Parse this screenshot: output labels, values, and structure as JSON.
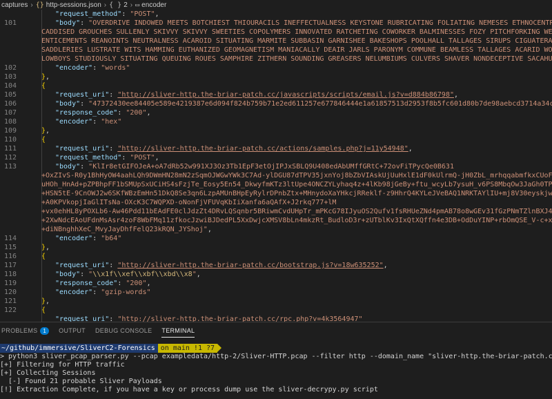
{
  "breadcrumb": {
    "root": "captures",
    "file_icon": "{}",
    "file": "http-sessions.json",
    "node_icon": "{ }",
    "node_num": "2",
    "node": "encoder"
  },
  "editor": {
    "lines": [
      {
        "n": "",
        "indent": 1,
        "html": "<span class='k'>\"request_method\"</span><span class='p'>: </span><span class='s'>\"POST\"</span><span class='p'>,</span>"
      },
      {
        "n": "101",
        "indent": 1,
        "html": "<span class='k'>\"body\"</span><span class='p'>: </span><span class='s'>\"OVERDRIVE INDOWED MEETS BOTCHIEST THIOURACILS INEFFECTUALNESS KEYSTONE RUBRICATING FOLIATING NEMESES ETHNOCENTRIC UNDERGOES FA</span>"
      },
      {
        "n": "",
        "indent": 0,
        "html": "<span class='s'>CADDISED GROUCHES SULLENLY SKIVVY SKIVVY SWEETIES COPOLYMERS INNOVATED RATCHETING COWORKER BALMINESSES FOZY PITCHFORKING WETTISH HUNGOV</span>"
      },
      {
        "n": "",
        "indent": 0,
        "html": "<span class='s'>ENTICEMENTS REANOINTS NEUTRALNESS ACAROID SITUATING MARMITE SUBBASIN GARNISHEE BAKESHOPS POOLHALL TALLAGES SIRUPS CIGUATERAS OMNIFIC IN</span>"
      },
      {
        "n": "",
        "indent": 0,
        "html": "<span class='s'>SADDLERIES LUSTRATE WITS HAMMING EUTHANIZED GEOMAGNETISM MANIACALLY DEAIR JARLS PARONYM COMMUNE BEAMLESS TALLAGES ACARID WOORALI SITUA</span>"
      },
      {
        "n": "",
        "indent": 0,
        "html": "<span class='s'>LOWBOYS STUDIOUSLY SITUATING QUEUING ROUES SAMPHIRE ZITHERN SOUNDING GREASERS NELUMBIUMS CULVERS SHAVER NONDECEPTIVE SACAHUISTE TWISTS</span>"
      },
      {
        "n": "102",
        "indent": 1,
        "html": "<span class='k'>\"encoder\"</span><span class='p'>: </span><span class='s'>\"words\"</span>"
      },
      {
        "n": "103",
        "indent": 0,
        "html": "<span class='y'>}</span><span class='p'>,</span>"
      },
      {
        "n": "104",
        "indent": 0,
        "html": "<span class='y'>{</span>"
      },
      {
        "n": "105",
        "indent": 1,
        "html": "<span class='k'>\"request_uri\"</span><span class='p'>: </span><span class='u'>\"http://sliver-http.the-briar-patch.cc/javascripts/scripts/email.js?v=d884b86798\"</span><span class='p'>,</span>"
      },
      {
        "n": "106",
        "indent": 1,
        "html": "<span class='k'>\"body\"</span><span class='p'>: </span><span class='s'>\"47372430ee84405e589e4219387e6d094f824b759b71e2ed611257e677846444e1a61857513d2953f8b5fc601d80b7de98aebcd3714a34c7dc2ba5bc1fc5d</span>"
      },
      {
        "n": "107",
        "indent": 1,
        "html": "<span class='k'>\"response_code\"</span><span class='p'>: </span><span class='s'>\"200\"</span><span class='p'>,</span>"
      },
      {
        "n": "108",
        "indent": 1,
        "html": "<span class='k'>\"encoder\"</span><span class='p'>: </span><span class='s'>\"hex\"</span>"
      },
      {
        "n": "109",
        "indent": 0,
        "html": "<span class='y'>}</span><span class='p'>,</span>"
      },
      {
        "n": "110",
        "indent": 0,
        "html": "<span class='y'>{</span>"
      },
      {
        "n": "111",
        "indent": 1,
        "html": "<span class='k'>\"request_uri\"</span><span class='p'>: </span><span class='u'>\"http://sliver-http.the-briar-patch.cc/actions/samples.php?j=11y54948\"</span><span class='p'>,</span>"
      },
      {
        "n": "112",
        "indent": 1,
        "html": "<span class='k'>\"request_method\"</span><span class='p'>: </span><span class='s'>\"POST\"</span><span class='p'>,</span>"
      },
      {
        "n": "113",
        "indent": 1,
        "html": "<span class='k'>\"body\"</span><span class='p'>: </span><span class='s'>\"KlIr8etGIFOJeA+oA7dRb52w991XJ3Oz3Tb1EpF3etOjIPJxSBLQ9U408edAbUMffGRtC+72ovFiTPycQe0B631</span>"
      },
      {
        "n": "",
        "indent": 0,
        "html": "<span class='s'>+OxZIvS-R0y1BhHyOW4aahLQh9DWmHN28mN2zSqmOJWGwYWk3C7Ad-ylDGU87dTPV35jxnYoj8bZbVIAskUjUuHxlE1dF0kUlrmQ-jH0ZbL_mrhqqabmfkxCUoFhALQrcPPAj2M</span>"
      },
      {
        "n": "",
        "indent": 0,
        "html": "<span class='s'>uHOh_HnAd+pZPBhpFF1bSMUpSxUCiHS4sFzjTe_Eosy5En54_DkwyfmKTz3ltUpe4ONCZYLyhaq4z+4lKb98jGeBy+ftu_wcyLb7ysuH_v6PS8MbqOw3JaGh0TP7q+vtw36MSv</span>"
      },
      {
        "n": "",
        "indent": 0,
        "html": "<span class='s'>+HSN5tE-9CnOWJ2w6SKfWBzEmHn51DkQ8Se3qn6LzpAMUnBHpEyRylrDPnbZtx+MHnydoXaYHkcjRReklf-z9HhrQ4KYLeJVeBAQ1NRKTAYlIU+mj8V30eyskjwuwbMHwNkeo4</span>"
      },
      {
        "n": "",
        "indent": 0,
        "html": "<span class='s'>+A0KPVkopjIaGlITsNa-OXcK3C7WQPXD-oNonFjVFUVqKbIiXanfa6aQAfX+J2rkq777+lM</span>"
      },
      {
        "n": "",
        "indent": 0,
        "html": "<span class='s'>+vx0ehHL8yPOXLb6-Aw46Pdd11bEAdFE0clJdzZt4DRvLQSqnbr5BRiwmCvdUHpTr_mPKcG78IJyuOS2Qufv1fsRHUeZNd4pmAB78o8wGEv31fGzPNmTZlnBXJ4tV81Uaey23P</span>"
      },
      {
        "n": "",
        "indent": 0,
        "html": "<span class='s'>+2XwNdcEAoUFdnMsAsr4zoF8WbFMq11zfkocJzwiBJDedPL5XxDwjcXMSV8bLn4mkzRt_BudloD3r+zUTblKv3IxQtXQffn4e3DB+OdDuYINP+rbOmQSE_V-c+xifee+vsExeN</span>"
      },
      {
        "n": "",
        "indent": 0,
        "html": "<span class='s'>+diNBnghhXeC_MvyJayDhfFelQ23kRQN_JYShoj\"</span><span class='p'>,</span>"
      },
      {
        "n": "114",
        "indent": 1,
        "html": "<span class='k'>\"encoder\"</span><span class='p'>: </span><span class='s'>\"b64\"</span>"
      },
      {
        "n": "115",
        "indent": 0,
        "html": "<span class='y'>}</span><span class='p'>,</span>"
      },
      {
        "n": "116",
        "indent": 0,
        "html": "<span class='y'>{</span>"
      },
      {
        "n": "117",
        "indent": 1,
        "html": "<span class='k'>\"request_uri\"</span><span class='p'>: </span><span class='u'>\"http://sliver-http.the-briar-patch.cc/bootstrap.js?v=18w635252\"</span><span class='p'>,</span>"
      },
      {
        "n": "118",
        "indent": 1,
        "html": "<span class='k'>\"body\"</span><span class='p'>: </span><span class='s'>\"</span><span class='esc'>\\\\x1f\\\\xef\\\\xbf\\\\xbd\\\\x8</span><span class='s'>\"</span><span class='p'>,</span>"
      },
      {
        "n": "119",
        "indent": 1,
        "html": "<span class='k'>\"response_code\"</span><span class='p'>: </span><span class='s'>\"200\"</span><span class='p'>,</span>"
      },
      {
        "n": "120",
        "indent": 1,
        "html": "<span class='k'>\"encoder\"</span><span class='p'>: </span><span class='s'>\"gzip-words\"</span>"
      },
      {
        "n": "121",
        "indent": 0,
        "html": "<span class='y'>}</span><span class='p'>,</span>"
      },
      {
        "n": "122",
        "indent": 0,
        "html": "<span class='y'>{</span>"
      },
      {
        "n": "",
        "indent": 1,
        "html": "<span class='k'>\"request_uri\"</span><span class='p'>: </span><span class='u'>\"http://sliver-http.the-briar-patch.cc/rpc.php?v=4k3564947\"</span>"
      }
    ]
  },
  "panel": {
    "tabs": [
      {
        "label": "PROBLEMS",
        "badge": "1",
        "active": false
      },
      {
        "label": "OUTPUT",
        "badge": "",
        "active": false
      },
      {
        "label": "DEBUG CONSOLE",
        "badge": "",
        "active": false
      },
      {
        "label": "TERMINAL",
        "badge": "",
        "active": true
      }
    ],
    "prompt": {
      "path": "~/github/immersive/SliverC2-Forensics",
      "git": "on main !1 ?7"
    },
    "command": "> python3 sliver_pcap_parser.py --pcap exampledata/http-2/Sliver-HTTP.pcap --filter http --domain_name \"sliver-http.the-briar-patch.cc\"",
    "output": [
      "[+] Filtering for HTTP traffic",
      "[+] Collecting Sessions",
      "  [-] Found 21 probable Sliver Payloads",
      "[!] Extraction Complete, if you have a key or process dump use the sliver-decrypy.py script"
    ]
  },
  "colors": {
    "background": "#1e1e1e",
    "key": "#9cdcfe",
    "string": "#ce9178",
    "bracket": "#ffd700",
    "tab_badge": "#007acc",
    "prompt_path_bg": "#1e3a6e",
    "prompt_git_bg": "#c8b800"
  }
}
